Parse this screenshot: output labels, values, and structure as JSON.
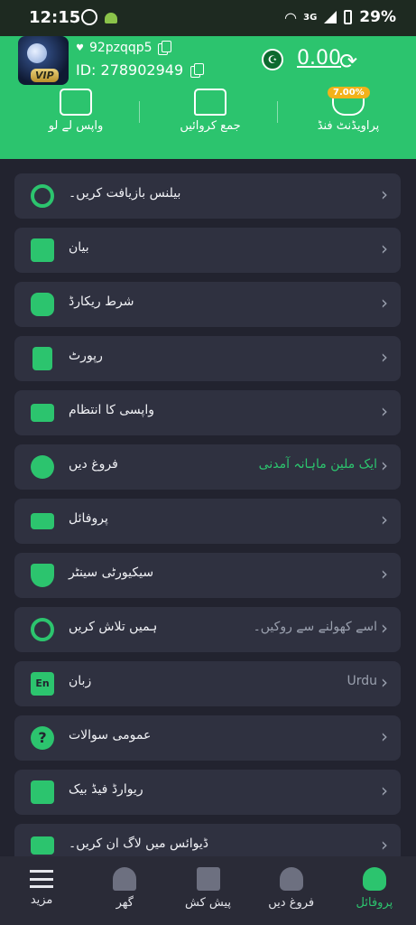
{
  "status_bar": {
    "time": "12:15",
    "network": "3G",
    "battery": "29%"
  },
  "header": {
    "username": "92pzqqp5",
    "user_id": "ID: 278902949",
    "vip_label": "VIP",
    "balance": "0.00",
    "actions": [
      {
        "label": "واپس لے لو",
        "icon": "withdraw-icon"
      },
      {
        "label": "جمع کروائیں",
        "icon": "wallet-icon"
      },
      {
        "label": "پراویڈنٹ فنڈ",
        "icon": "provident-fund-icon",
        "badge": "7.00%"
      }
    ]
  },
  "menu": [
    {
      "label": "بیلنس بازیافت کریں۔",
      "icon": "balance-recover-icon",
      "value": ""
    },
    {
      "label": "بیان",
      "icon": "statement-icon",
      "value": ""
    },
    {
      "label": "شرط ریکارڈ",
      "icon": "bet-record-icon",
      "value": ""
    },
    {
      "label": "رپورٹ",
      "icon": "report-icon",
      "value": ""
    },
    {
      "label": "واپسی کا انتظام",
      "icon": "withdraw-manage-icon",
      "value": ""
    },
    {
      "label": "فروغ دیں",
      "icon": "promote-icon",
      "value": "ایک ملین ماہانہ آمدنی"
    },
    {
      "label": "پروفائل",
      "icon": "profile-card-icon",
      "value": ""
    },
    {
      "label": "سیکیورٹی سینٹر",
      "icon": "shield-icon",
      "value": ""
    },
    {
      "label": "ہمیں تلاش کریں",
      "icon": "find-us-icon",
      "value": "اسے کھولنے سے روکیں۔"
    },
    {
      "label": "زبان",
      "icon": "language-icon",
      "value": "Urdu"
    },
    {
      "label": "عمومی سوالات",
      "icon": "faq-icon",
      "value": ""
    },
    {
      "label": "ریوارڈ فیڈ بیک",
      "icon": "feedback-icon",
      "value": ""
    },
    {
      "label": "ڈیوائس میں لاگ ان کریں۔",
      "icon": "device-login-icon",
      "value": ""
    }
  ],
  "bottom_nav": [
    {
      "label": "مزید",
      "icon": "menu-icon"
    },
    {
      "label": "گھر",
      "icon": "home-icon"
    },
    {
      "label": "پیش کش",
      "icon": "gift-icon"
    },
    {
      "label": "فروغ دیں",
      "icon": "promote-nav-icon"
    },
    {
      "label": "پروفائل",
      "icon": "profile-icon",
      "active": true
    }
  ],
  "colors": {
    "accent": "#2cc46e",
    "background": "#22232f",
    "card": "#2f3140",
    "badge": "#f2b21a"
  }
}
